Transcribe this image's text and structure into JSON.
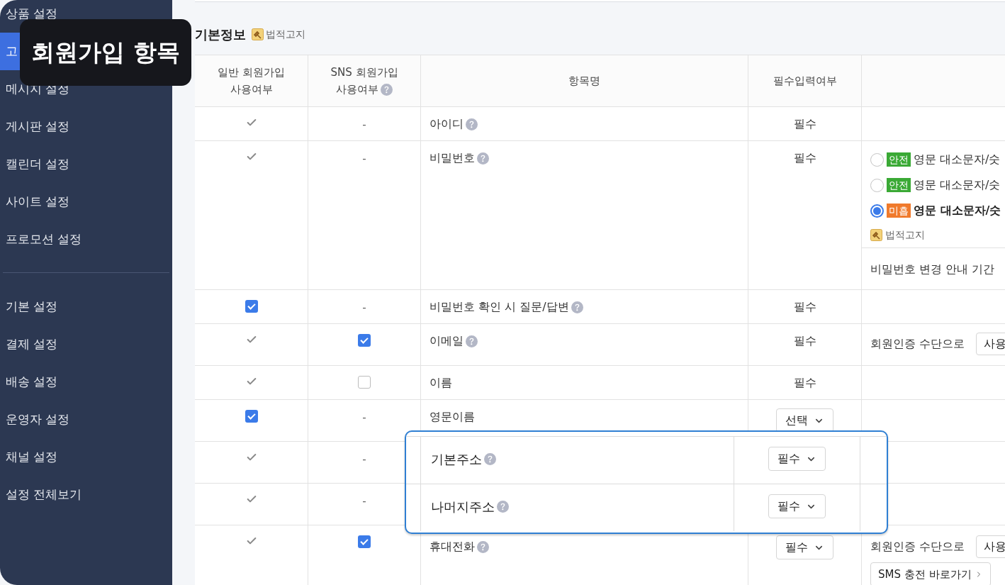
{
  "caption": "회원가입 항목",
  "sidebar": {
    "groups": [
      {
        "items": [
          {
            "label": "상품 설정",
            "selected": false
          },
          {
            "label": "고",
            "selected": true
          },
          {
            "label": "메시지 설정",
            "selected": false
          },
          {
            "label": "게시판 설정",
            "selected": false
          },
          {
            "label": "캘린더 설정",
            "selected": false
          },
          {
            "label": "사이트 설정",
            "selected": false
          },
          {
            "label": "프로모션 설정",
            "selected": false
          }
        ]
      },
      {
        "items": [
          {
            "label": "기본 설정",
            "selected": false
          },
          {
            "label": "결제 설정",
            "selected": false
          },
          {
            "label": "배송 설정",
            "selected": false
          },
          {
            "label": "운영자 설정",
            "selected": false
          },
          {
            "label": "채널 설정",
            "selected": false
          },
          {
            "label": "설정 전체보기",
            "selected": false
          }
        ]
      }
    ]
  },
  "section": {
    "title": "기본정보",
    "notice": "법적고지"
  },
  "table": {
    "columns": [
      {
        "label": "일반 회원가입\n사용여부",
        "help": false
      },
      {
        "label": "SNS 회원가입\n사용여부",
        "help": true
      },
      {
        "label": "항목명",
        "help": false
      },
      {
        "label": "필수입력여부",
        "help": false
      }
    ],
    "rows": [
      {
        "general": {
          "kind": "fixed"
        },
        "sns": {
          "kind": "dash",
          "text": "-"
        },
        "name": "아이디",
        "help": true,
        "required": {
          "kind": "text",
          "text": "필수"
        }
      },
      {
        "general": {
          "kind": "fixed"
        },
        "sns": {
          "kind": "dash",
          "text": "-"
        },
        "name": "비밀번호",
        "help": true,
        "required": {
          "kind": "text",
          "text": "필수"
        },
        "extra": {
          "kind": "password",
          "options": [
            {
              "badge": "안전",
              "color": "#3aa935",
              "text": "영문 대소문자/숫",
              "selected": false
            },
            {
              "badge": "안전",
              "color": "#3aa935",
              "text": "영문 대소문자/숫",
              "selected": false
            },
            {
              "badge": "미흡",
              "color": "#f07a2c",
              "text": "영문 대소문자/숫",
              "selected": true
            }
          ],
          "notice": "법적고지",
          "period_label": "비밀번호 변경 안내 기간"
        }
      },
      {
        "general": {
          "kind": "checkbox",
          "checked": true
        },
        "sns": {
          "kind": "dash",
          "text": "-"
        },
        "name": "비밀번호 확인 시 질문/답변",
        "help": true,
        "required": {
          "kind": "text",
          "text": "필수"
        }
      },
      {
        "general": {
          "kind": "fixed"
        },
        "sns": {
          "kind": "checkbox",
          "checked": true
        },
        "name": "이메일",
        "help": true,
        "required": {
          "kind": "text",
          "text": "필수"
        },
        "extra": {
          "kind": "auth",
          "label": "회원인증 수단으로",
          "select": "사용"
        }
      },
      {
        "general": {
          "kind": "fixed"
        },
        "sns": {
          "kind": "checkbox",
          "checked": false
        },
        "name": "이름",
        "help": false,
        "required": {
          "kind": "text",
          "text": "필수"
        }
      },
      {
        "general": {
          "kind": "checkbox",
          "checked": true
        },
        "sns": {
          "kind": "dash",
          "text": "-"
        },
        "name": "영문이름",
        "help": false,
        "required": {
          "kind": "select",
          "text": "선택"
        }
      },
      {
        "general": {
          "kind": "fixed"
        },
        "sns": {
          "kind": "dash",
          "text": "-"
        }
      },
      {
        "general": {
          "kind": "fixed"
        },
        "sns": {
          "kind": "dash",
          "text": "-"
        }
      },
      {
        "general": {
          "kind": "fixed"
        },
        "sns": {
          "kind": "checkbox",
          "checked": true
        },
        "name": "휴대전화",
        "help": true,
        "required": {
          "kind": "select",
          "text": "필수"
        },
        "extra": {
          "kind": "auth",
          "label": "회원인증 수단으로",
          "select": "사용",
          "button": "SMS 충전 바로가기"
        }
      }
    ]
  },
  "callout": {
    "rows": [
      {
        "name": "기본주소",
        "help": true,
        "required": "필수"
      },
      {
        "name": "나머지주소",
        "help": true,
        "required": "필수"
      }
    ]
  }
}
